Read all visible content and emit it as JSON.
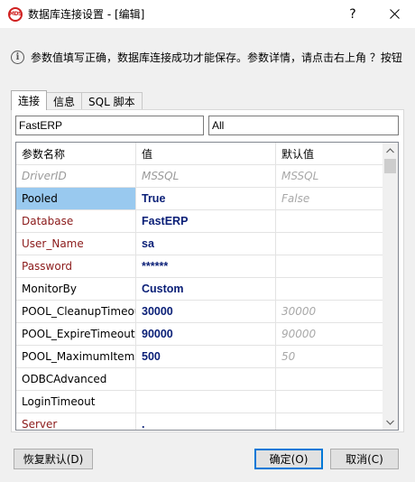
{
  "window": {
    "title": "数据库连接设置 - [编辑]",
    "help_label": "?",
    "app_icon_text": "MDS"
  },
  "info": {
    "text": "参数值填写正确，数据库连接成功才能保存。参数详情，请点击右上角 ？按钮"
  },
  "tabs": [
    {
      "label": "连接",
      "active": true
    },
    {
      "label": "信息",
      "active": false
    },
    {
      "label": "SQL 脚本",
      "active": false
    }
  ],
  "connection": {
    "name_value": "FastERP",
    "filter_value": "All"
  },
  "grid": {
    "headers": {
      "name": "参数名称",
      "value": "值",
      "default": "默认值"
    },
    "rows": [
      {
        "name": "DriverID",
        "value": "MSSQL",
        "default": "MSSQL",
        "name_style": "gray",
        "value_style": "gray"
      },
      {
        "name": "Pooled",
        "value": "True",
        "default": "False",
        "name_style": "black",
        "value_style": "bold",
        "selected": true
      },
      {
        "name": "Database",
        "value": "FastERP",
        "default": "",
        "name_style": "red",
        "value_style": "bold"
      },
      {
        "name": "User_Name",
        "value": "sa",
        "default": "",
        "name_style": "red",
        "value_style": "bold"
      },
      {
        "name": "Password",
        "value": "******",
        "default": "",
        "name_style": "red",
        "value_style": "bold"
      },
      {
        "name": "MonitorBy",
        "value": "Custom",
        "default": "",
        "name_style": "black",
        "value_style": "bold"
      },
      {
        "name": "POOL_CleanupTimeout",
        "value": "30000",
        "default": "30000",
        "name_style": "black",
        "value_style": "bold"
      },
      {
        "name": "POOL_ExpireTimeout",
        "value": "90000",
        "default": "90000",
        "name_style": "black",
        "value_style": "bold"
      },
      {
        "name": "POOL_MaximumItems",
        "value": "500",
        "default": "50",
        "name_style": "black",
        "value_style": "bold"
      },
      {
        "name": "ODBCAdvanced",
        "value": "",
        "default": "",
        "name_style": "black",
        "value_style": "bold"
      },
      {
        "name": "LoginTimeout",
        "value": "",
        "default": "",
        "name_style": "black",
        "value_style": "bold"
      },
      {
        "name": "Server",
        "value": ".",
        "default": "",
        "name_style": "red",
        "value_style": "bold"
      }
    ]
  },
  "buttons": {
    "restore": "恢复默认(D)",
    "ok": "确定(O)",
    "cancel": "取消(C)"
  },
  "colors": {
    "accent": "#0078d7",
    "required_param": "#8b1a1a",
    "value_text": "#0a1f77",
    "selection": "#99c9ef"
  }
}
